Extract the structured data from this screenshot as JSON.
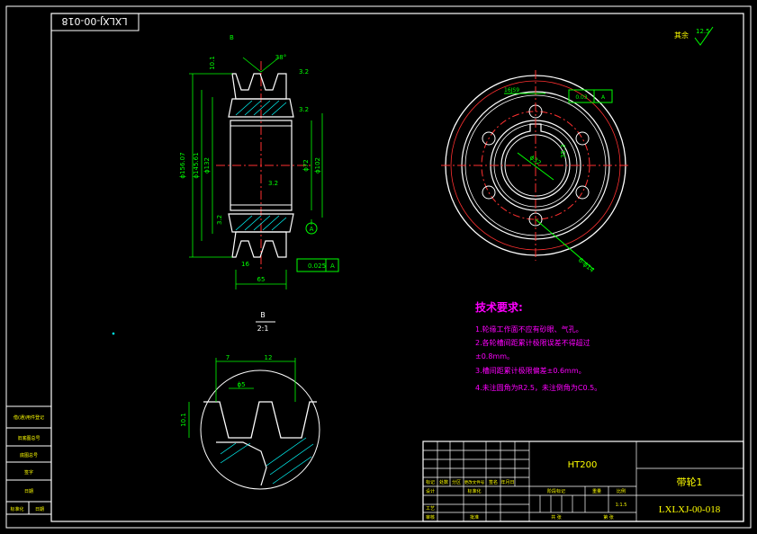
{
  "colors": {
    "background": "#000000",
    "frame": "#ffffff",
    "outline": "#ffffff",
    "dimension": "#00ff00",
    "centerline": "#ff3030",
    "hatch": "#00ffff",
    "notes": "#ff00ff",
    "titleblock_text": "#ffff00"
  },
  "stamp": {
    "code": "LXLXJ-00-018"
  },
  "roughness_note": {
    "label": "其余",
    "value": "12.5"
  },
  "front_view": {
    "dims": {
      "overall_dia": "ϕ156.07",
      "mid_dia": "ϕ145.61",
      "pitch_dia": "ϕ132",
      "bore_dia": "ϕ72",
      "hub_dia": "ϕ102",
      "width": "65",
      "groove_top": "10.1",
      "angle": "38°",
      "rough_a": "3.2",
      "rough_b": "3.2",
      "rough_c": "3.2",
      "rough_d": "3.2",
      "gd_tol": "0.025",
      "datum": "A",
      "detail_ref": "B",
      "small_mark": "16"
    }
  },
  "side_view": {
    "keyway": "16JS9",
    "keyway_tol": "0.03",
    "datum": "A",
    "bore_label": "ϕ32",
    "depth_label": "35.3",
    "holes_label": "6-ϕ14"
  },
  "detail": {
    "label": "B",
    "scale": "2:1",
    "dim_top_a": "7",
    "dim_top_b": "12",
    "dim_width": "ϕ5",
    "dim_depth": "10.1"
  },
  "requirements": {
    "title": "技术要求:",
    "items": [
      "1.轮缘工作面不应有砂眼、气孔。",
      "2.各轮槽间距累计极限误差不得超过",
      "±0.8mm。",
      "3.槽间距累计极限偏差±0.6mm。",
      "4.未注圆角为R2.5，未注倒角为C0.5。"
    ]
  },
  "titleblock": {
    "material": "HT200",
    "part_name": "带轮1",
    "drawing_no": "LXLXJ-00-018",
    "scale": "1:1.5",
    "row_labels": [
      "标记",
      "处数",
      "分区",
      "更改文件号",
      "签名",
      "年月日"
    ],
    "col_labels": [
      "阶段标记",
      "重量",
      "比例"
    ],
    "design": "设计",
    "standard": "标准化",
    "check": "审核",
    "process": "工艺",
    "approve": "批准",
    "sheet_a": "共 张",
    "sheet_b": "第 张"
  },
  "side_table": {
    "rows": [
      "借(通)用件登记",
      "旧底图总号",
      "底图总号",
      "签字",
      "日期"
    ],
    "footer": [
      "标准化",
      "日期"
    ]
  }
}
